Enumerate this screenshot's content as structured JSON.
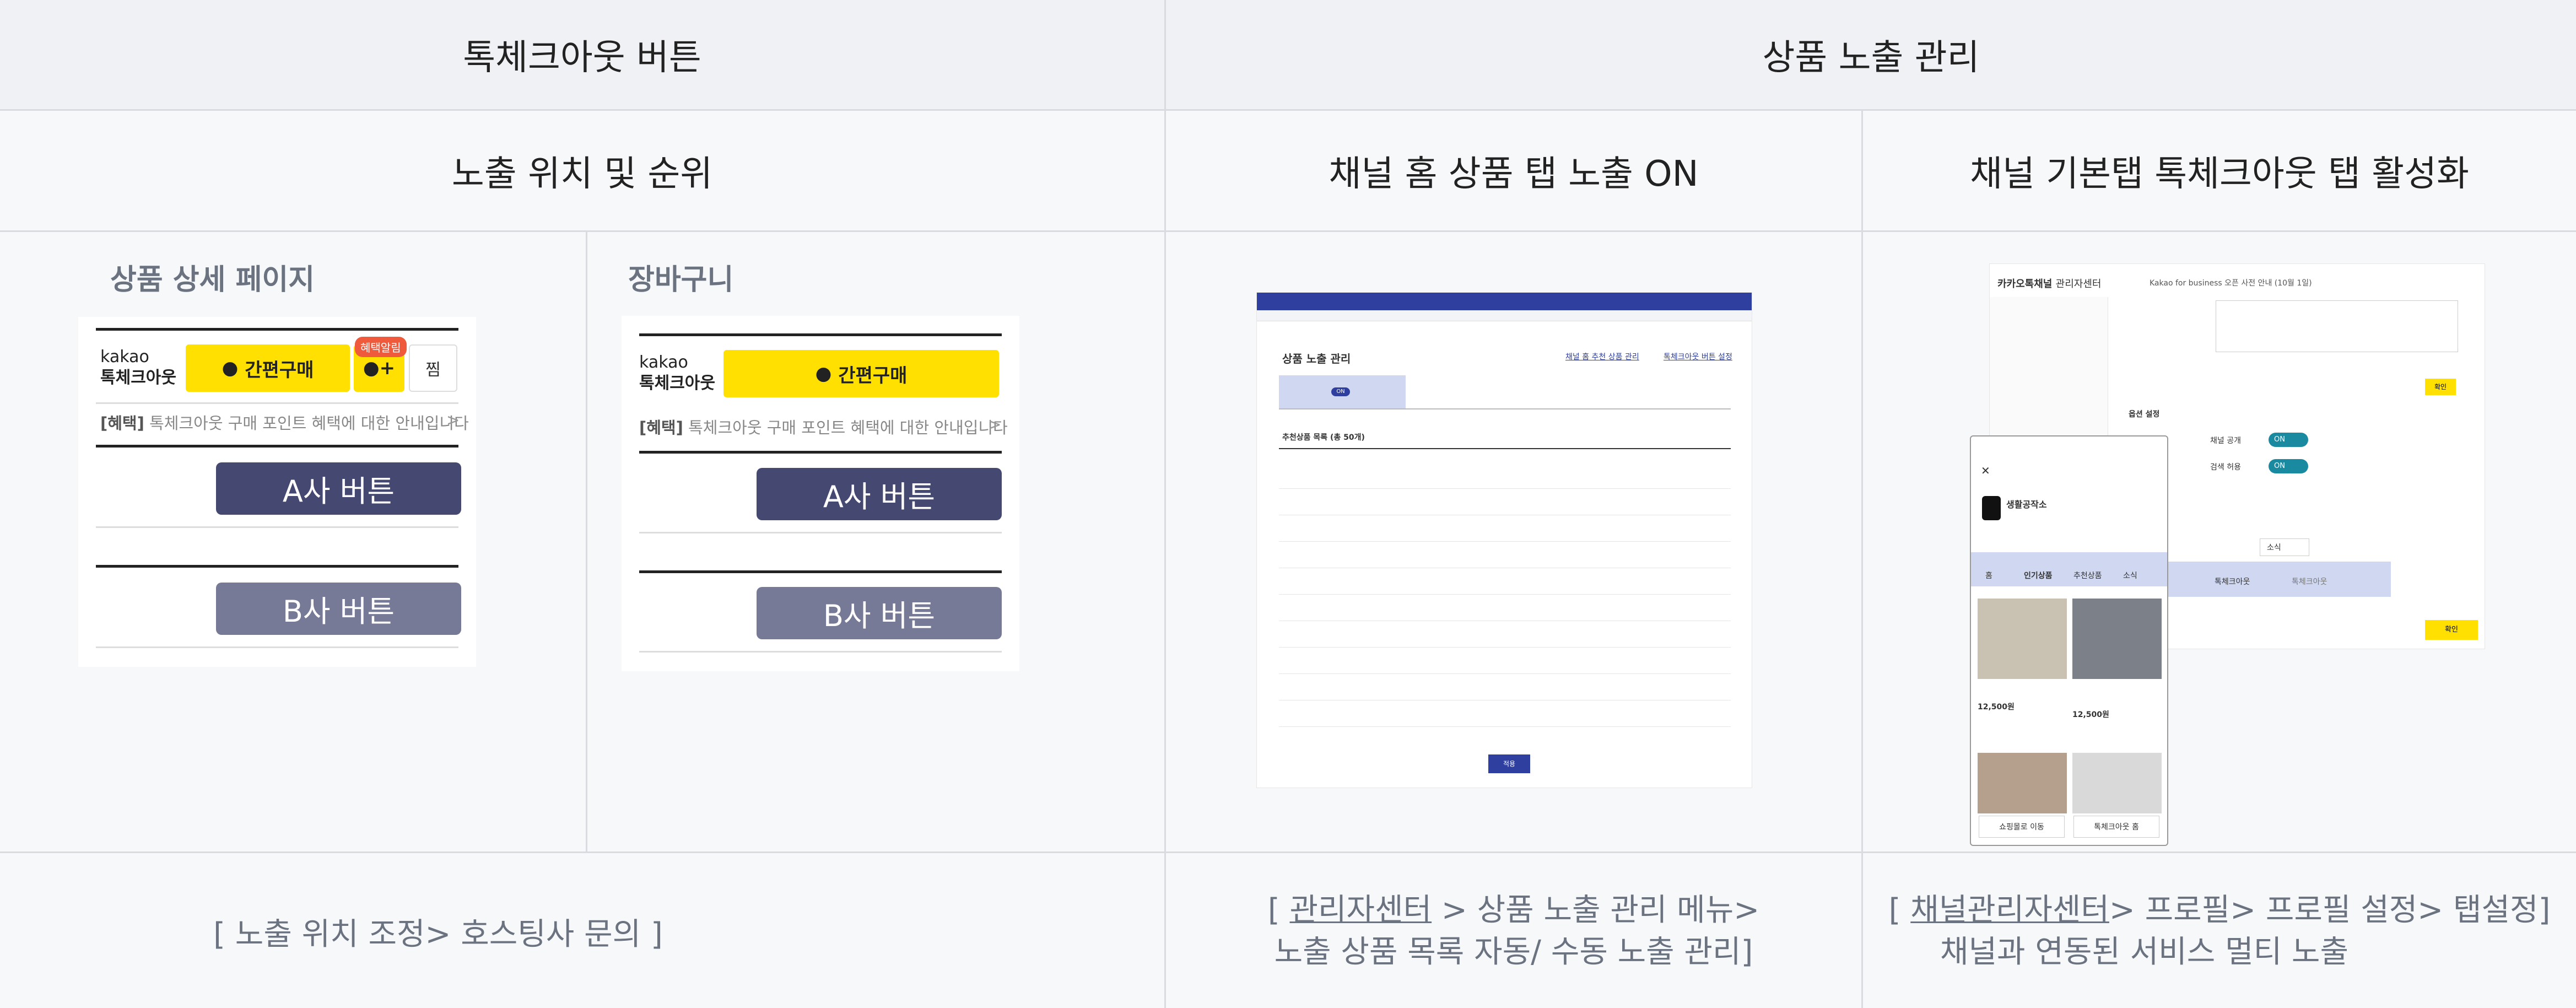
{
  "headers": {
    "toss_button": "톡체크아웃 버튼",
    "exposure_mgmt": "상품 노출 관리",
    "position_rank": "노출 위치 및 순위",
    "channel_home": "채널 홈 상품 탭 노출 ON",
    "channel_tab": "채널 기본탭 톡체크아웃 탭 활성화"
  },
  "detail": {
    "title": "상품 상세 페이지",
    "kakao": "kakao",
    "talk": "톡체크아웃",
    "buy": "간편구매",
    "badge": "혜택알림",
    "plus": "+",
    "zzim": "찜",
    "benefit_tag": "[혜택]",
    "benefit_text": "톡체크아웃 구매 포인트 혜택에 대한 안내입니다",
    "chev": ">",
    "a_btn": "A사 버튼",
    "b_btn": "B사 버튼"
  },
  "cart": {
    "title": "장바구니",
    "kakao": "kakao",
    "talk": "톡체크아웃",
    "buy": "간편구매",
    "benefit_tag": "[혜택]",
    "benefit_text": "톡체크아웃 구매 포인트 혜택에 대한 안내입니다",
    "chev": ">",
    "a_btn": "A사 버튼",
    "b_btn": "B사 버튼"
  },
  "footer": {
    "col1": "[ 노출 위치 조정> 호스팅사 문의 ]",
    "col2_a": "[ ",
    "col2_link": "관리자센터",
    "col2_b": " > 상품 노출 관리 메뉴>",
    "col2_c": "노출 상품 목록 자동/ 수동 노출 관리]",
    "col3_a": "[ ",
    "col3_link": "채널관리자센터",
    "col3_b": "> 프로필> 프로필 설정> 탭설정]",
    "col3_c": "채널과 연동된 서비스 멀티 노출"
  },
  "shot1": {
    "title": "상품 노출 관리",
    "link1": "채널 홈 추천 상품 관리",
    "link2": "톡체크아웃 버튼 설정",
    "list": "추천상품 목록 (총 50개)",
    "toggle": "ON",
    "save": "적용"
  },
  "shot2": {
    "logo": "카카오톡채널",
    "logo_sub": "관리자센터",
    "bar": "Kakao for business 오픈 사전 안내 (10월 1일)",
    "sec": "옵션 설정",
    "r1": "채널 공개",
    "r2": "검색 허용",
    "on": "ON",
    "btn": "확인",
    "store": "생활공작소",
    "tabs": [
      "홈",
      "인기상품",
      "추천상품",
      "소식"
    ],
    "p1": "12,500원",
    "p2": "12,500원",
    "b1": "쇼핑몰로 이동",
    "b2": "톡체크아웃 홈",
    "tab1": "톡체크아웃",
    "tab2": "톡체크아웃",
    "sel": "소식"
  },
  "colors": {
    "navy": "#454870",
    "slate": "#777a96",
    "yellow": "#ffe000",
    "kakao_blue": "#2f3f9f"
  }
}
